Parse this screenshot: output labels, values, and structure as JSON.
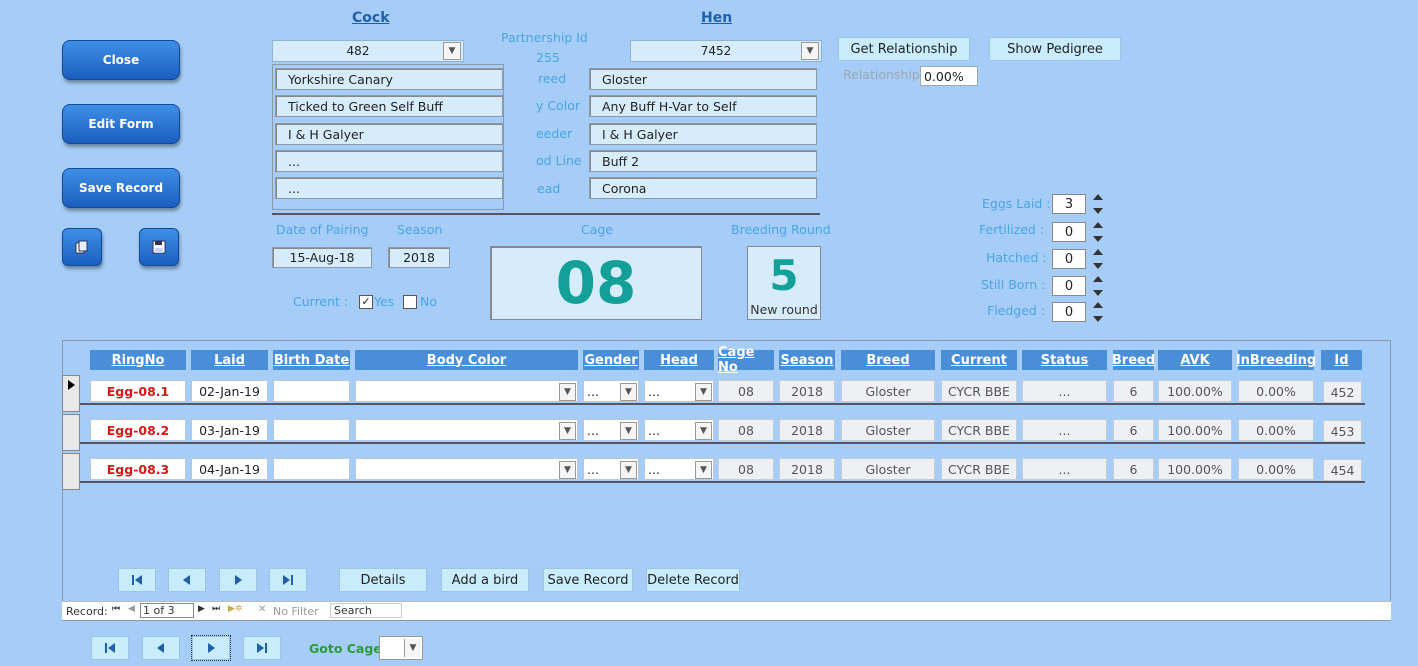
{
  "sidebar": {
    "close_label": "Close",
    "edit_label": "Edit Form",
    "save_label": "Save Record"
  },
  "cock": {
    "title": "Cock",
    "id": "482",
    "breed": "Yorkshire Canary",
    "color": "Ticked to Green Self Buff",
    "breeder": "I & H Galyer",
    "blood_line": "...",
    "head": "..."
  },
  "hen": {
    "title": "Hen",
    "id": "7452",
    "breed": "Gloster",
    "color": "Any Buff H-Var to Self",
    "breeder": "I & H Galyer",
    "blood_line": "Buff 2",
    "head": "Corona"
  },
  "partnership": {
    "label": "Partnership Id",
    "value": "255"
  },
  "center_labels": [
    "reed",
    "y Color",
    "eeder",
    "od Line",
    "ead"
  ],
  "relationship": {
    "get_label": "Get Relationship",
    "pedigree_label": "Show Pedigree",
    "label": "Relationship",
    "value": "0.00%"
  },
  "pairing": {
    "date_label": "Date of Pairing",
    "date_value": "15-Aug-18",
    "season_label": "Season",
    "season_value": "2018",
    "current_label": "Current :",
    "yes_label": "Yes",
    "no_label": "No",
    "yes_checked": true,
    "no_checked": false
  },
  "cage": {
    "label": "Cage",
    "value": "08"
  },
  "round": {
    "label": "Breeding Round",
    "value": "5",
    "caption": "New round"
  },
  "counters": [
    {
      "label": "Eggs Laid :",
      "value": "3"
    },
    {
      "label": "Fertilized :",
      "value": "0"
    },
    {
      "label": "Hatched :",
      "value": "0"
    },
    {
      "label": "Still Born :",
      "value": "0"
    },
    {
      "label": "Fledged :",
      "value": "0"
    }
  ],
  "grid": {
    "headers": [
      "RingNo",
      "Laid",
      "Birth Date",
      "Body Color",
      "Gender",
      "Head",
      "Cage No",
      "Season",
      "Breed",
      "Current",
      "Status",
      "Breed",
      "AVK",
      "InBreeding",
      "Id"
    ],
    "rows": [
      {
        "ring": "Egg-08.1",
        "laid": "02-Jan-19",
        "birth": "",
        "color": "",
        "gender": "...",
        "head": "...",
        "cage": "08",
        "season": "2018",
        "breed": "Gloster",
        "current": "CYCR BBE",
        "status": "...",
        "breed2": "6",
        "avk": "100.00%",
        "inb": "0.00%",
        "id": "452"
      },
      {
        "ring": "Egg-08.2",
        "laid": "03-Jan-19",
        "birth": "",
        "color": "",
        "gender": "...",
        "head": "...",
        "cage": "08",
        "season": "2018",
        "breed": "Gloster",
        "current": "CYCR BBE",
        "status": "...",
        "breed2": "6",
        "avk": "100.00%",
        "inb": "0.00%",
        "id": "453"
      },
      {
        "ring": "Egg-08.3",
        "laid": "04-Jan-19",
        "birth": "",
        "color": "",
        "gender": "...",
        "head": "...",
        "cage": "08",
        "season": "2018",
        "breed": "Gloster",
        "current": "CYCR BBE",
        "status": "...",
        "breed2": "6",
        "avk": "100.00%",
        "inb": "0.00%",
        "id": "454"
      }
    ],
    "details_label": "Details",
    "add_label": "Add a bird",
    "save_label": "Save Record",
    "delete_label": "Delete Record"
  },
  "record_bar": {
    "label": "Record:",
    "position": "1 of 3",
    "filter_label": "No Filter",
    "search_label": "Search"
  },
  "goto": {
    "label": "Goto Cage",
    "value": ""
  }
}
